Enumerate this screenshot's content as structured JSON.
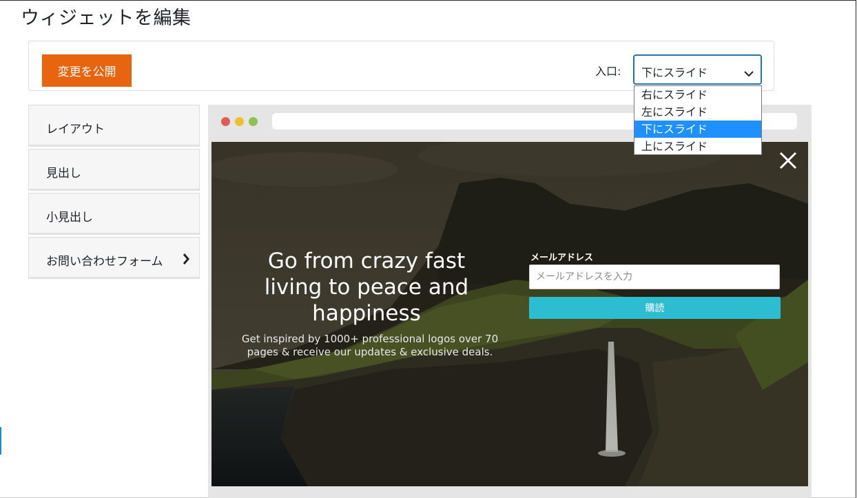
{
  "page": {
    "title": "ウィジェットを編集"
  },
  "toolbar": {
    "publish_label": "変更を公開",
    "entry_label": "入口:",
    "entry_value": "下にスライド",
    "entry_options": [
      "右にスライド",
      "左にスライド",
      "下にスライド",
      "上にスライド"
    ],
    "selected_option": "下にスライド"
  },
  "sidebar": {
    "items": [
      {
        "label": "レイアウト"
      },
      {
        "label": "見出し"
      },
      {
        "label": "小見出し"
      },
      {
        "label": "お問い合わせフォーム"
      }
    ]
  },
  "preview": {
    "headline": [
      "Go from crazy fast",
      "living to peace and",
      "happiness"
    ],
    "subline": [
      "Get inspired by 1000+ professional logos over 70",
      "pages & receive our updates & exclusive deals."
    ],
    "email_label": "メールアドレス",
    "email_placeholder": "メールアドレスを入力",
    "subscribe_label": "購読"
  },
  "colors": {
    "publish_button": "#e8640f",
    "select_border": "#2271b1",
    "selected_option": "#1e90ff",
    "subscribe_button": "#2dbdd1",
    "dot_red": "#e05c56",
    "dot_yellow": "#f0bf2e",
    "dot_green": "#8dc152"
  }
}
